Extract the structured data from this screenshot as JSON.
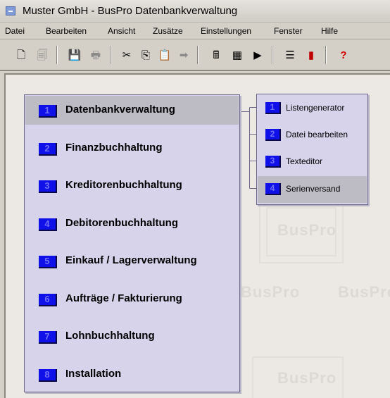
{
  "window": {
    "title": "Muster GmbH - BusPro Datenbankverwaltung"
  },
  "menu": [
    "Datei",
    "Bearbeiten",
    "Ansicht",
    "Zusätze",
    "Einstellungen",
    "Fenster",
    "Hilfe"
  ],
  "toolbar": [
    {
      "name": "new-document-icon",
      "glyph": "🗋",
      "enabled": true
    },
    {
      "name": "print-preview-icon",
      "glyph": "🗐",
      "enabled": false
    },
    {
      "name": "save-icon",
      "glyph": "💾",
      "enabled": false
    },
    {
      "name": "print-icon",
      "glyph": "🖶",
      "enabled": false
    },
    {
      "name": "cut-icon",
      "glyph": "✂",
      "enabled": true
    },
    {
      "name": "copy-icon",
      "glyph": "⎘",
      "enabled": true
    },
    {
      "name": "paste-icon",
      "glyph": "📋",
      "enabled": true
    },
    {
      "name": "forward-icon",
      "glyph": "➡",
      "enabled": false
    },
    {
      "name": "calculator-icon",
      "glyph": "🖩",
      "enabled": true
    },
    {
      "name": "calendar-icon",
      "glyph": "▦",
      "enabled": true
    },
    {
      "name": "play-icon",
      "glyph": "▶",
      "enabled": true
    },
    {
      "name": "list-icon",
      "glyph": "☰",
      "enabled": true
    },
    {
      "name": "exit-door-icon",
      "glyph": "▮",
      "enabled": true
    },
    {
      "name": "help-icon",
      "glyph": "?",
      "enabled": true
    }
  ],
  "watermark": "BusPro",
  "colors": {
    "accent": "#1010e8",
    "panel": "#d6d3ea",
    "highlight": "#bdbbc3",
    "help": "#d40000",
    "exit": "#c00000"
  },
  "main_menu": [
    {
      "num": "1",
      "label": "Datenbankverwaltung",
      "active": true
    },
    {
      "num": "2",
      "label": "Finanzbuchhaltung",
      "active": false
    },
    {
      "num": "3",
      "label": "Kreditorenbuchhaltung",
      "active": false
    },
    {
      "num": "4",
      "label": "Debitorenbuchhaltung",
      "active": false
    },
    {
      "num": "5",
      "label": "Einkauf / Lagerverwaltung",
      "active": false
    },
    {
      "num": "6",
      "label": "Aufträge / Fakturierung",
      "active": false
    },
    {
      "num": "7",
      "label": "Lohnbuchhaltung",
      "active": false
    },
    {
      "num": "8",
      "label": "Installation",
      "active": false
    }
  ],
  "sub_menu": [
    {
      "num": "1",
      "label": "Listengenerator",
      "active": false
    },
    {
      "num": "2",
      "label": "Datei bearbeiten",
      "active": false
    },
    {
      "num": "3",
      "label": "Texteditor",
      "active": false
    },
    {
      "num": "4",
      "label": "Serienversand",
      "active": true
    }
  ]
}
